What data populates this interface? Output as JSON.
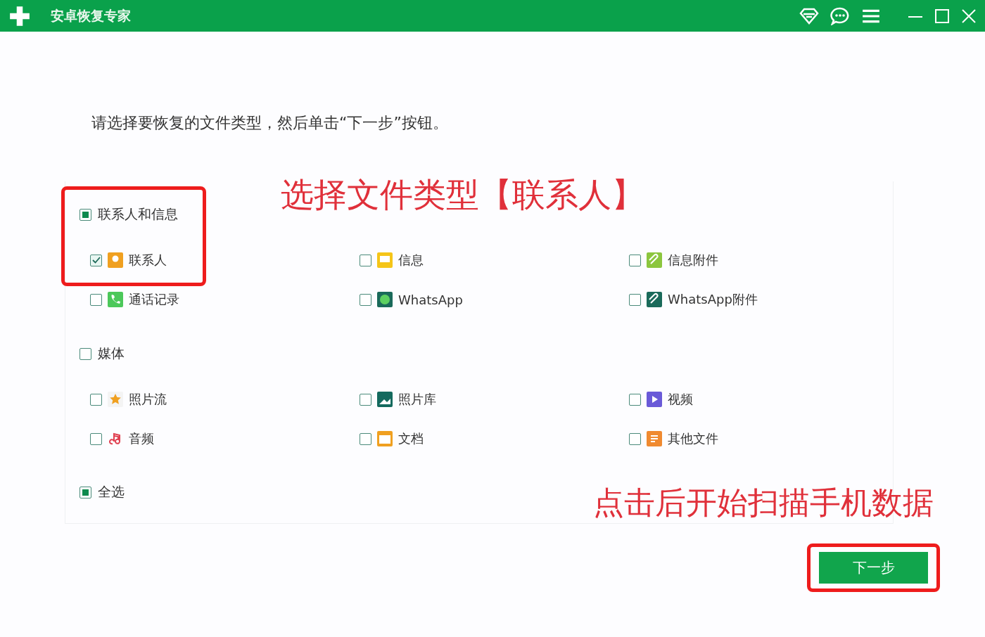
{
  "window": {
    "title": "安卓恢复专家"
  },
  "instruction": "请选择要恢复的文件类型，然后单击“下一步”按钮。",
  "groups": [
    {
      "label": "联系人和信息",
      "checked": false,
      "partial": true,
      "items": [
        {
          "label": "联系人",
          "checked": true
        },
        {
          "label": "信息",
          "checked": false
        },
        {
          "label": "信息附件",
          "checked": false
        },
        {
          "label": "通话记录",
          "checked": false
        },
        {
          "label": "WhatsApp",
          "checked": false
        },
        {
          "label": "WhatsApp附件",
          "checked": false
        }
      ]
    },
    {
      "label": "媒体",
      "checked": false,
      "partial": false,
      "items": [
        {
          "label": "照片流",
          "checked": false
        },
        {
          "label": "照片库",
          "checked": false
        },
        {
          "label": "视频",
          "checked": false
        },
        {
          "label": "音频",
          "checked": false
        },
        {
          "label": "文档",
          "checked": false
        },
        {
          "label": "其他文件",
          "checked": false
        }
      ]
    }
  ],
  "select_all": {
    "label": "全选",
    "checked": false,
    "partial": true
  },
  "next_button": "下一步",
  "annotations": [
    "选择文件类型【联系人】",
    "点击后开始扫描手机数据"
  ]
}
